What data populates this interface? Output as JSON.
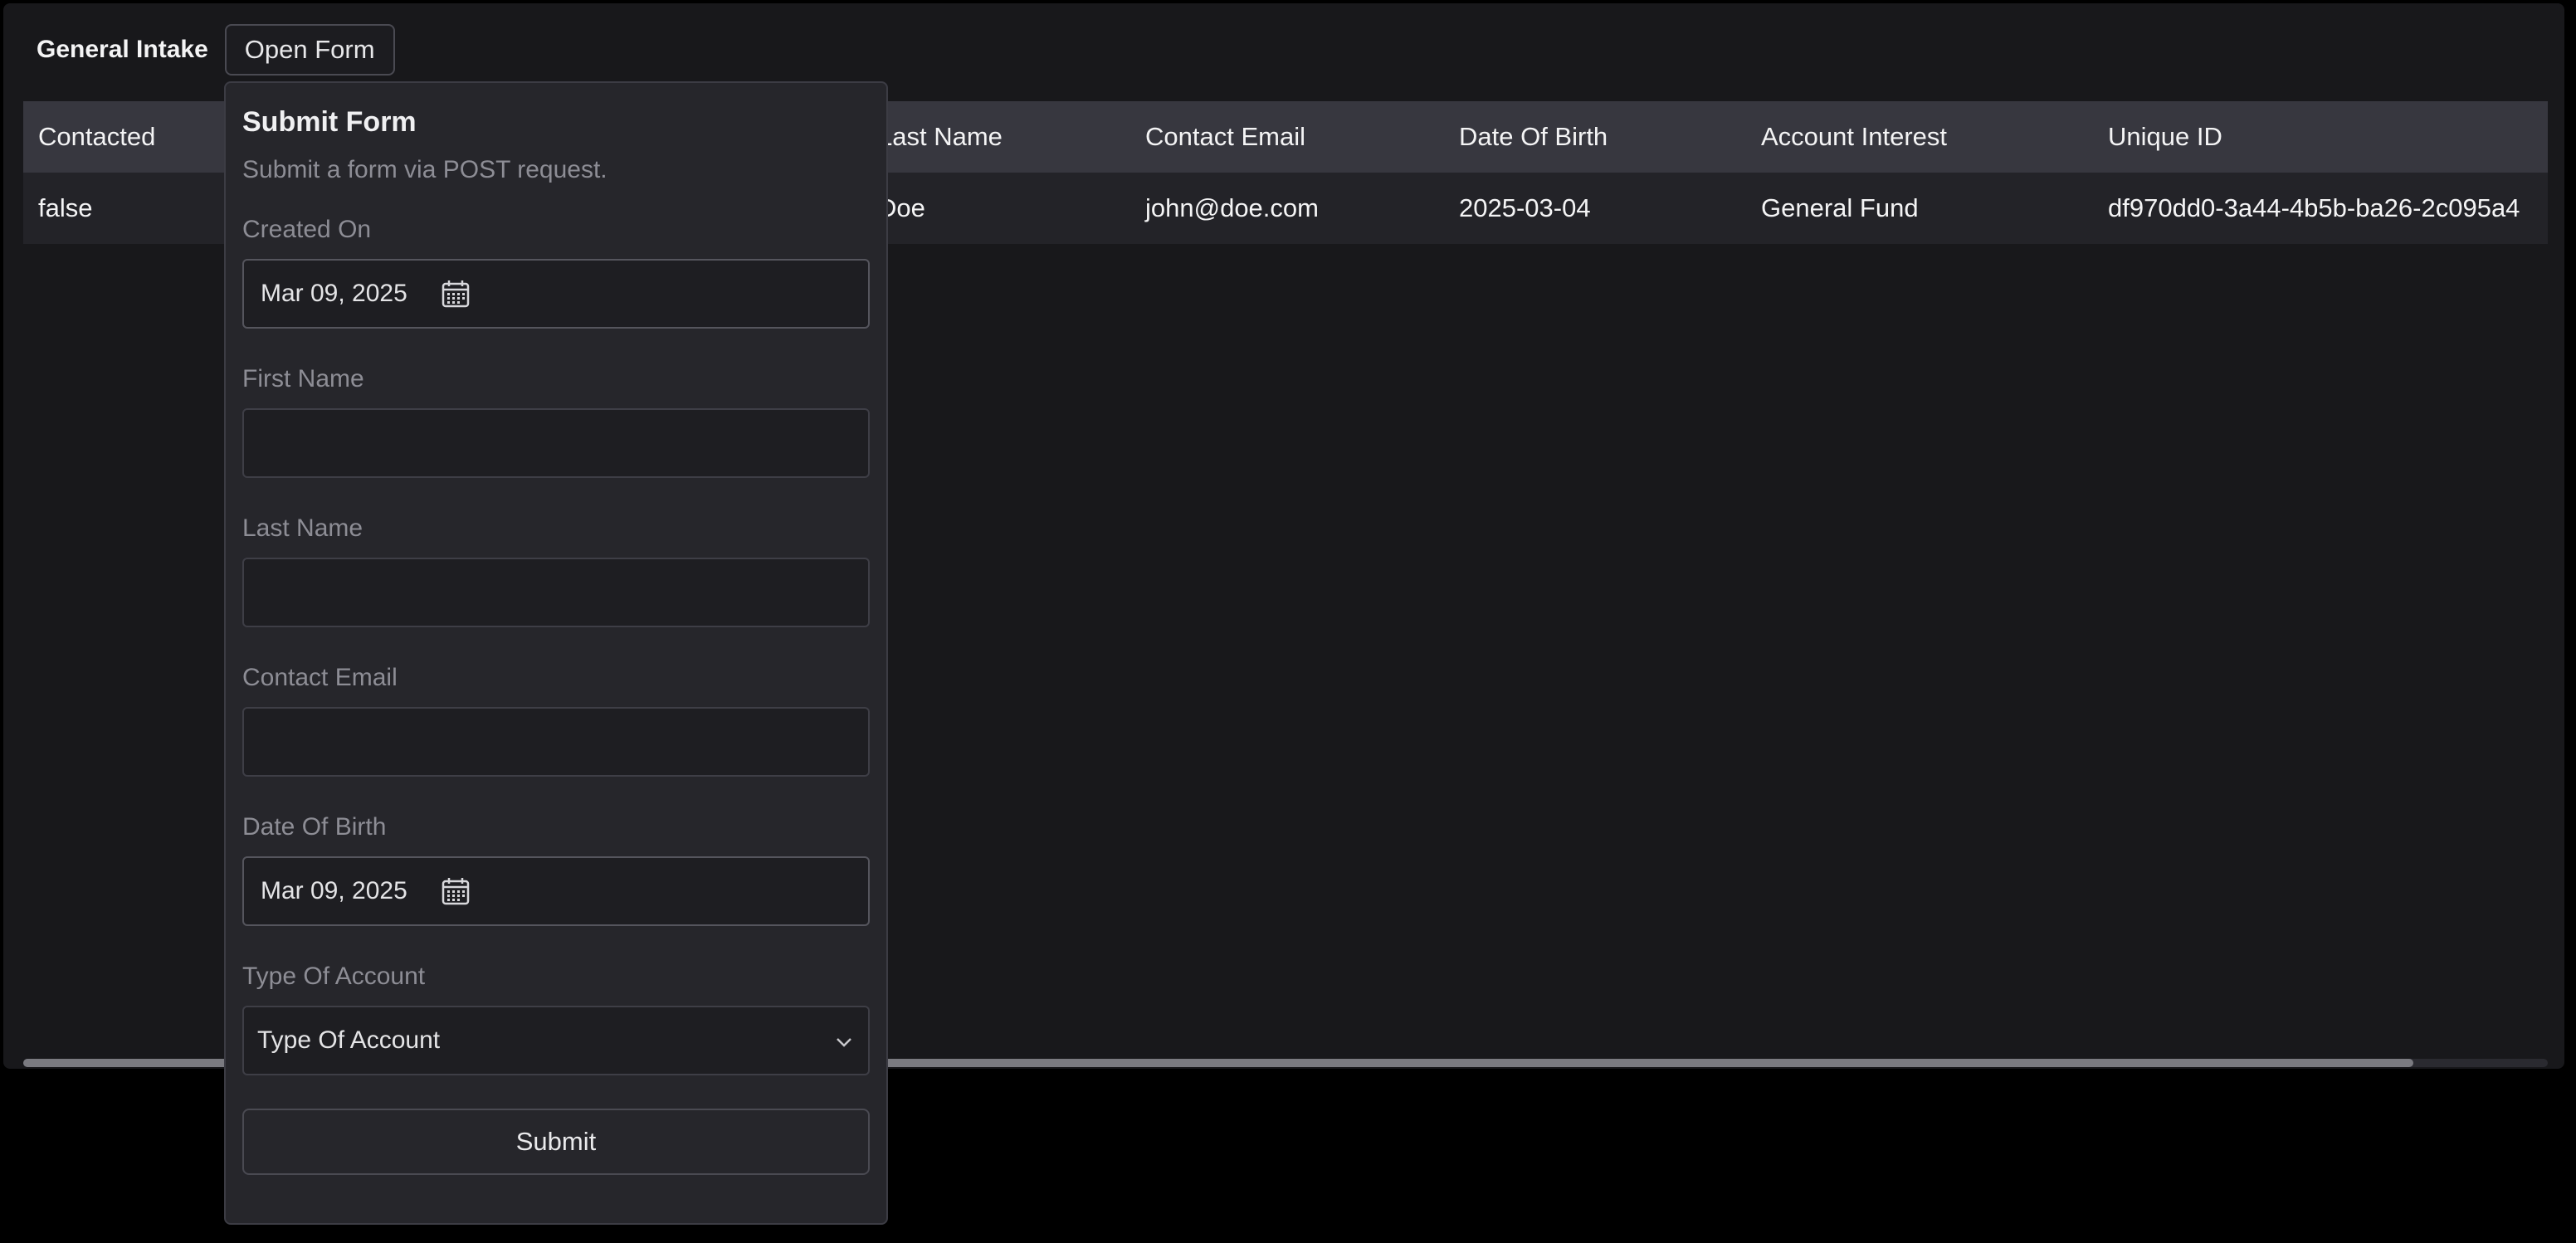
{
  "app": {
    "title": "General Intake",
    "open_form_label": "Open Form"
  },
  "table": {
    "headers": [
      "Contacted",
      "Last Name",
      "Contact Email",
      "Date Of Birth",
      "Account Interest",
      "Unique ID"
    ],
    "rows": [
      [
        "false",
        "Doe",
        "john@doe.com",
        "2025-03-04",
        "General Fund",
        "df970dd0-3a44-4b5b-ba26-2c095a4"
      ]
    ]
  },
  "form": {
    "title": "Submit Form",
    "description": "Submit a form via POST request.",
    "fields": {
      "created_on": {
        "label": "Created On",
        "value": "Mar 09, 2025"
      },
      "first_name": {
        "label": "First Name",
        "value": ""
      },
      "last_name": {
        "label": "Last Name",
        "value": ""
      },
      "contact_email": {
        "label": "Contact Email",
        "value": ""
      },
      "date_of_birth": {
        "label": "Date Of Birth",
        "value": "Mar 09, 2025"
      },
      "type_of_account": {
        "label": "Type Of Account",
        "selected": "Type Of Account"
      }
    },
    "submit_label": "Submit"
  },
  "icons": {
    "date": "calendar-icon",
    "select": "chevron-down-icon"
  },
  "colors": {
    "page_bg": "#000000",
    "panel_bg": "#18181b",
    "header_row_bg": "#37373f",
    "body_row_bg": "#232328",
    "popover_bg": "#26262b",
    "muted_text": "#8d8d95"
  }
}
